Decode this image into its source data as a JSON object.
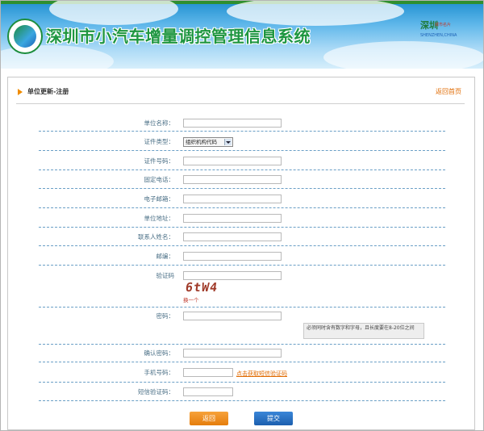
{
  "header": {
    "title": "深圳市小汽车增量调控管理信息系统",
    "city_logo_title": "深圳",
    "city_logo_sub": "城市名片",
    "city_logo_en": "SHENZHEN,CHINA"
  },
  "section": {
    "title": "单位更新-注册",
    "home_link": "返回首页"
  },
  "form": {
    "fields": [
      {
        "label": "单位名称：",
        "value": ""
      },
      {
        "label": "证件类型：",
        "value": "组织机构代码"
      },
      {
        "label": "证件号码：",
        "value": ""
      },
      {
        "label": "固定电话：",
        "value": ""
      },
      {
        "label": "电子邮箱：",
        "value": ""
      },
      {
        "label": "单位地址：",
        "value": ""
      },
      {
        "label": "联系人姓名：",
        "value": ""
      },
      {
        "label": "邮编：",
        "value": ""
      },
      {
        "label": "验证码",
        "value": ""
      },
      {
        "label": "密码：",
        "value": ""
      },
      {
        "label": "确认密码：",
        "value": ""
      },
      {
        "label": "手机号码：",
        "value": ""
      },
      {
        "label": "短信验证码：",
        "value": ""
      }
    ],
    "captcha_text": "6tW4",
    "captcha_refresh": "换一个",
    "password_tip": "必须同时含有数字和字母，且长度要在8-20位之间",
    "sms_link": "点击获取短信验证码",
    "back_button": "返回",
    "submit_button": "提交"
  }
}
